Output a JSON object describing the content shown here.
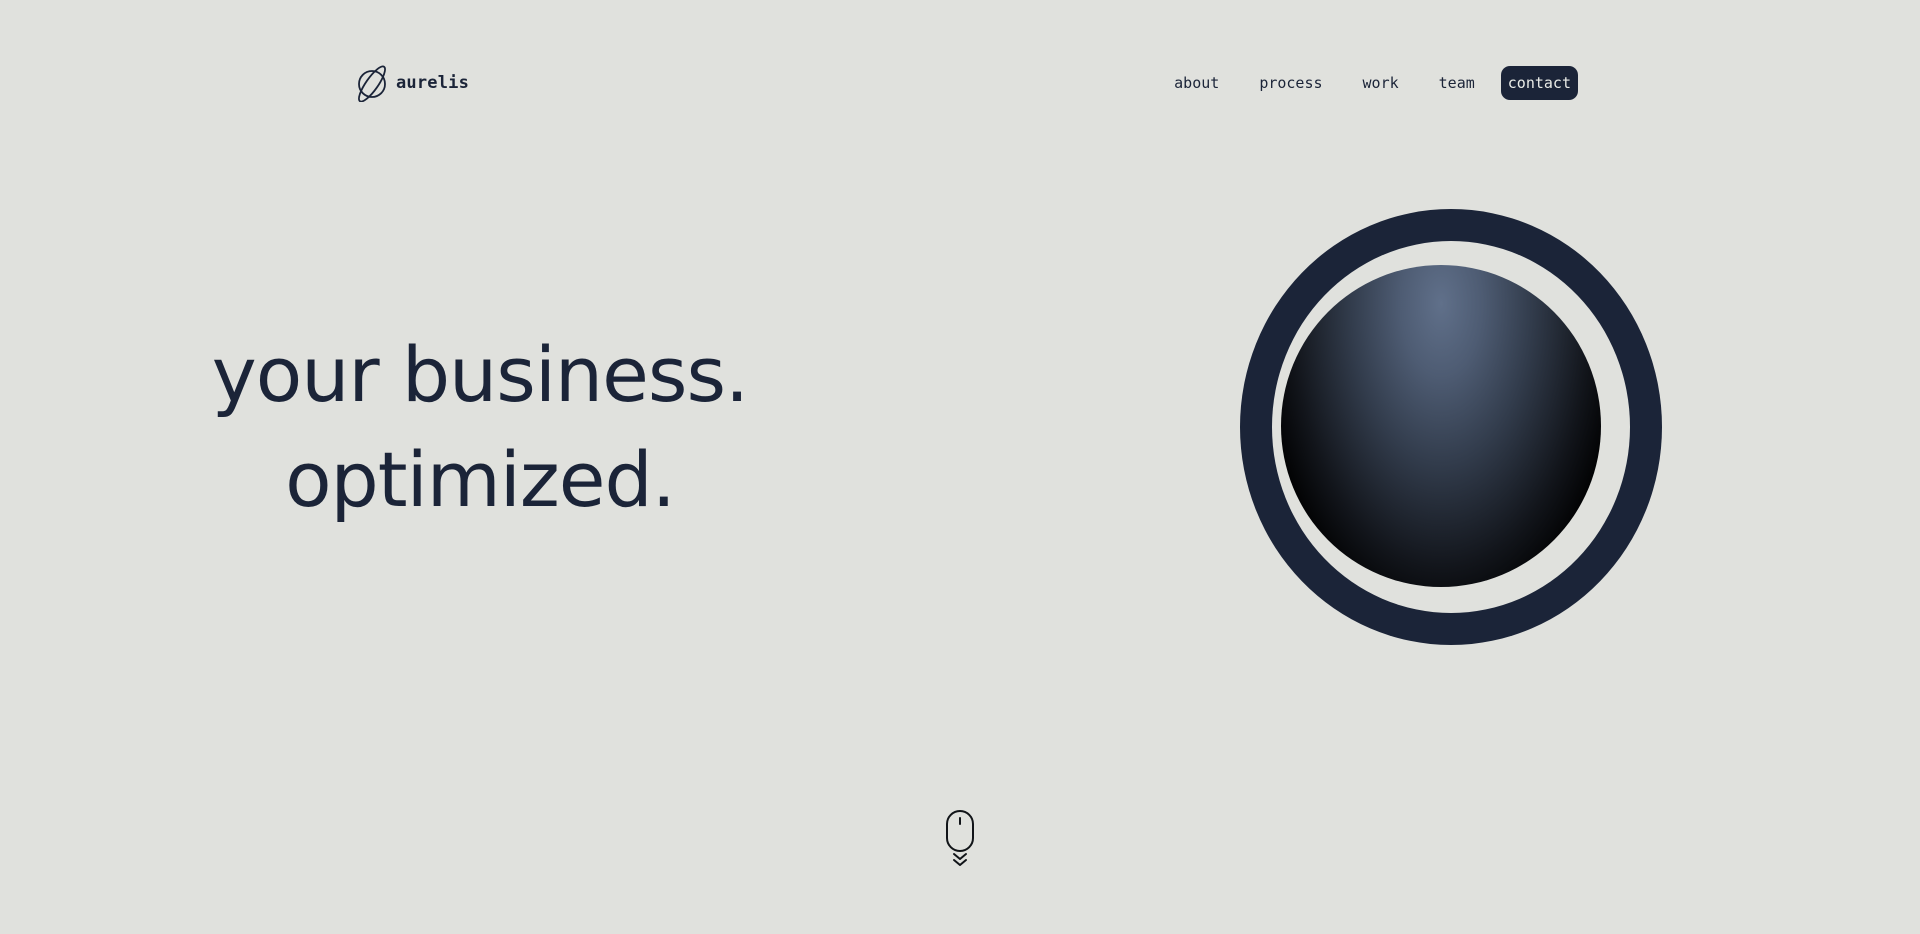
{
  "brand": {
    "name": "aurelis",
    "logo_icon": "planet-icon"
  },
  "nav": {
    "items": [
      {
        "label": "about"
      },
      {
        "label": "process"
      },
      {
        "label": "work"
      },
      {
        "label": "team"
      },
      {
        "label": "contact",
        "active": true
      }
    ]
  },
  "hero": {
    "line1": "your business.",
    "line2": "optimized."
  },
  "scroll_indicator": {
    "icon": "mouse-scroll-icon"
  },
  "colors": {
    "background": "#e0e1dd",
    "primary": "#1b2438",
    "nav_active_text": "#e9ebe7"
  }
}
